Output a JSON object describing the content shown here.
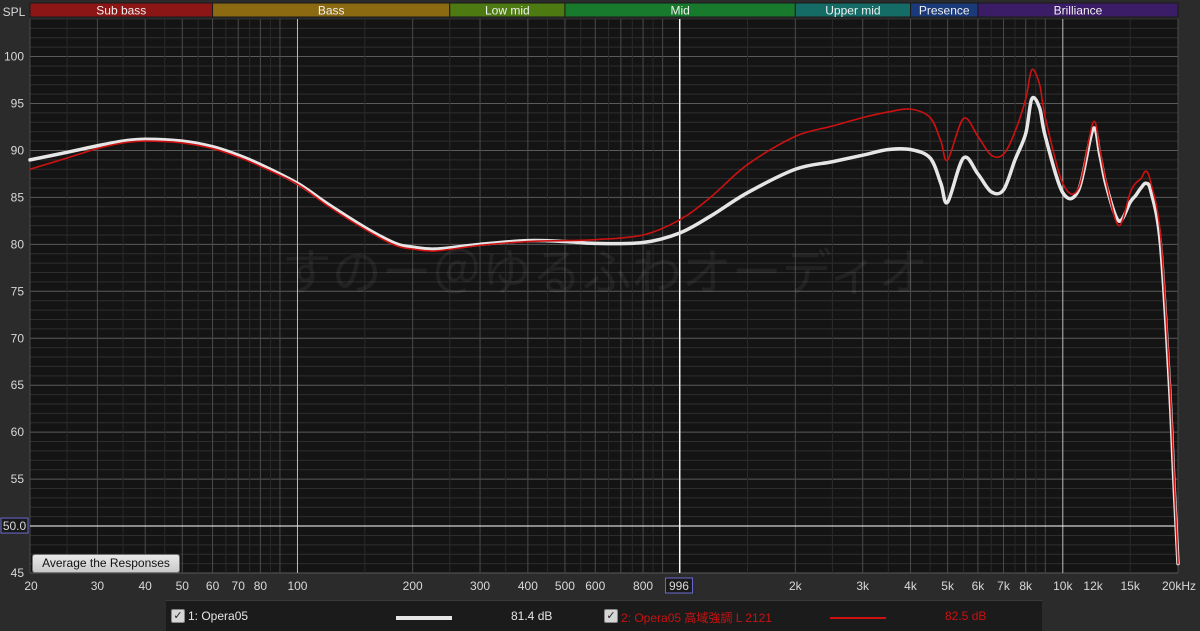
{
  "chart_data": {
    "type": "line",
    "ylabel": "SPL",
    "xunit": "Hz",
    "ylim": [
      45,
      104
    ],
    "xlim": [
      20,
      20000
    ],
    "log_x": true,
    "grid": true,
    "watermark": "すのー＠ゆるふわオーディオ",
    "cursor": {
      "x_label": "996",
      "y_label": "50.0",
      "x": 996,
      "y": 50
    },
    "y_ticks": [
      45,
      50,
      55,
      60,
      65,
      70,
      75,
      80,
      85,
      90,
      95,
      100
    ],
    "x_ticks": [
      {
        "v": 20,
        "l": "20"
      },
      {
        "v": 30,
        "l": "30"
      },
      {
        "v": 40,
        "l": "40"
      },
      {
        "v": 50,
        "l": "50"
      },
      {
        "v": 60,
        "l": "60"
      },
      {
        "v": 70,
        "l": "70"
      },
      {
        "v": 80,
        "l": "80"
      },
      {
        "v": 100,
        "l": "100"
      },
      {
        "v": 200,
        "l": "200"
      },
      {
        "v": 300,
        "l": "300"
      },
      {
        "v": 400,
        "l": "400"
      },
      {
        "v": 500,
        "l": "500"
      },
      {
        "v": 600,
        "l": "600"
      },
      {
        "v": 800,
        "l": "800"
      },
      {
        "v": 2000,
        "l": "2k"
      },
      {
        "v": 3000,
        "l": "3k"
      },
      {
        "v": 4000,
        "l": "4k"
      },
      {
        "v": 5000,
        "l": "5k"
      },
      {
        "v": 6000,
        "l": "6k"
      },
      {
        "v": 7000,
        "l": "7k"
      },
      {
        "v": 8000,
        "l": "8k"
      },
      {
        "v": 10000,
        "l": "10k"
      },
      {
        "v": 12000,
        "l": "12k"
      },
      {
        "v": 15000,
        "l": "15k"
      },
      {
        "v": 20000,
        "l": "20kHz"
      }
    ],
    "bands": [
      {
        "name": "Sub bass",
        "from": 20,
        "to": 60,
        "color": "#8c1515"
      },
      {
        "name": "Bass",
        "from": 60,
        "to": 250,
        "color": "#8c6a12"
      },
      {
        "name": "Low mid",
        "from": 250,
        "to": 500,
        "color": "#4e7a12"
      },
      {
        "name": "Mid",
        "from": 500,
        "to": 2000,
        "color": "#187a2c"
      },
      {
        "name": "Upper mid",
        "from": 2000,
        "to": 4000,
        "color": "#156c66"
      },
      {
        "name": "Presence",
        "from": 4000,
        "to": 6000,
        "color": "#1b3a7a"
      },
      {
        "name": "Brilliance",
        "from": 6000,
        "to": 20000,
        "color": "#3b1c66"
      }
    ],
    "series": [
      {
        "name": "1: Opera05",
        "value_label": "81.4 dB",
        "color": "#e6e6e6",
        "x": [
          20,
          25,
          30,
          35,
          40,
          50,
          60,
          70,
          80,
          100,
          120,
          150,
          180,
          200,
          230,
          300,
          400,
          500,
          600,
          800,
          996,
          1200,
          1500,
          2000,
          2500,
          3000,
          3500,
          4000,
          4500,
          4800,
          5000,
          5500,
          6000,
          6500,
          7000,
          7500,
          8000,
          8300,
          8700,
          9000,
          10000,
          11000,
          12000,
          12500,
          13000,
          14000,
          15000,
          15500,
          16000,
          16500,
          17000,
          18000,
          19000,
          19500,
          20000
        ],
        "y": [
          89,
          89.8,
          90.5,
          91,
          91.2,
          91,
          90.4,
          89.5,
          88.5,
          86.5,
          84.3,
          81.8,
          80.1,
          79.7,
          79.5,
          80.0,
          80.4,
          80.3,
          80.1,
          80.2,
          81.2,
          83.0,
          85.5,
          88.0,
          88.8,
          89.5,
          90.1,
          90.1,
          89.2,
          86.5,
          84.5,
          89.2,
          87.5,
          85.6,
          85.8,
          89.0,
          91.8,
          95.5,
          94.5,
          91.5,
          85.5,
          85.8,
          92.3,
          89.5,
          86.2,
          82.5,
          84.5,
          85.2,
          86.0,
          86.5,
          85.6,
          80.0,
          65.0,
          55.0,
          46.0
        ]
      },
      {
        "name": "2: Opera05 高域強調 L 2121",
        "value_label": "82.5 dB",
        "color": "#cc1111",
        "x": [
          20,
          25,
          30,
          35,
          40,
          50,
          60,
          70,
          80,
          100,
          120,
          150,
          180,
          200,
          230,
          300,
          400,
          500,
          600,
          800,
          996,
          1200,
          1500,
          2000,
          2500,
          3000,
          3500,
          4000,
          4500,
          4800,
          5000,
          5500,
          6000,
          6500,
          7000,
          7500,
          8000,
          8300,
          8700,
          9000,
          10000,
          11000,
          12000,
          12500,
          13000,
          14000,
          15000,
          15500,
          16000,
          16500,
          17000,
          18000,
          19000,
          19500,
          20000
        ],
        "y": [
          88,
          89.2,
          90.2,
          90.8,
          91.0,
          90.8,
          90.2,
          89.3,
          88.3,
          86.4,
          84.1,
          81.6,
          79.9,
          79.5,
          79.3,
          79.9,
          80.3,
          80.4,
          80.5,
          81.0,
          82.6,
          85.0,
          88.5,
          91.5,
          92.6,
          93.5,
          94.1,
          94.4,
          93.5,
          91.0,
          89.0,
          93.4,
          91.5,
          89.5,
          89.6,
          92.0,
          95.5,
          98.6,
          97.0,
          93.5,
          86.5,
          86.0,
          93.0,
          90.0,
          86.5,
          82.0,
          85.5,
          86.5,
          87.0,
          87.8,
          86.5,
          81.0,
          66.0,
          56.0,
          46.0
        ]
      }
    ]
  },
  "ui": {
    "average_button_label": "Average the Responses",
    "checkbox_mark": "✓"
  }
}
